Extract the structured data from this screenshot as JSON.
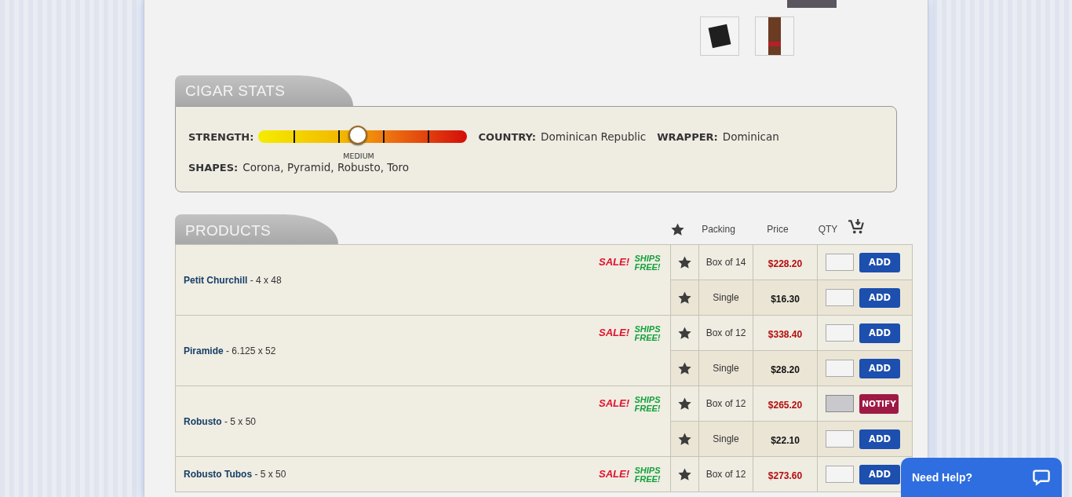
{
  "gallery": {
    "thumbnails": [
      {
        "kind": "box"
      },
      {
        "kind": "cigar"
      }
    ]
  },
  "cigar_stats": {
    "title": "CIGAR STATS",
    "strength": {
      "label": "STRENGTH:",
      "level": 0.48,
      "reading": "MEDIUM"
    },
    "fields": [
      {
        "label": "COUNTRY:",
        "value": "Dominican Republic"
      },
      {
        "label": "WRAPPER:",
        "value": "Dominican"
      }
    ],
    "shapes": {
      "label": "SHAPES:",
      "value": "Corona, Pyramid, Robusto, Toro"
    }
  },
  "products": {
    "title": "PRODUCTS",
    "columns": [
      "Packing",
      "Price",
      "QTY"
    ],
    "rows": [
      {
        "name": "Petit Churchill",
        "size": "- 4 x 48",
        "badges": [
          {
            "kind": "sale",
            "text": "SALE!"
          },
          {
            "kind": "ships_free",
            "text": "SHIPS FREE!"
          }
        ],
        "variants": [
          {
            "packing": "Box of 14",
            "price": "$228.20",
            "on_sale": true,
            "disabled": false,
            "button": {
              "kind": "add",
              "label": "ADD"
            }
          },
          {
            "packing": "Single",
            "price": "$16.30",
            "on_sale": false,
            "disabled": false,
            "button": {
              "kind": "add",
              "label": "ADD"
            }
          }
        ]
      },
      {
        "name": "Piramide",
        "size": "- 6.125 x 52",
        "badges": [
          {
            "kind": "sale",
            "text": "SALE!"
          },
          {
            "kind": "ships_free",
            "text": "SHIPS FREE!"
          }
        ],
        "variants": [
          {
            "packing": "Box of 12",
            "price": "$338.40",
            "on_sale": true,
            "disabled": false,
            "button": {
              "kind": "add",
              "label": "ADD"
            }
          },
          {
            "packing": "Single",
            "price": "$28.20",
            "on_sale": false,
            "disabled": false,
            "button": {
              "kind": "add",
              "label": "ADD"
            }
          }
        ]
      },
      {
        "name": "Robusto",
        "size": "- 5 x 50",
        "badges": [
          {
            "kind": "sale",
            "text": "SALE!"
          },
          {
            "kind": "ships_free",
            "text": "SHIPS FREE!"
          }
        ],
        "variants": [
          {
            "packing": "Box of 12",
            "price": "$265.20",
            "on_sale": true,
            "disabled": true,
            "button": {
              "kind": "notify",
              "label": "NOTIFY"
            }
          },
          {
            "packing": "Single",
            "price": "$22.10",
            "on_sale": false,
            "disabled": false,
            "button": {
              "kind": "add",
              "label": "ADD"
            }
          }
        ]
      },
      {
        "name": "Robusto Tubos",
        "size": "- 5 x 50",
        "badges": [
          {
            "kind": "sale",
            "text": "SALE!"
          },
          {
            "kind": "ships_free",
            "text": "SHIPS FREE!"
          }
        ],
        "variants": [
          {
            "packing": "Box of 12",
            "price": "$273.60",
            "on_sale": true,
            "disabled": false,
            "button": {
              "kind": "add",
              "label": "ADD"
            }
          }
        ]
      }
    ]
  },
  "chat": {
    "label": "Need Help?"
  }
}
